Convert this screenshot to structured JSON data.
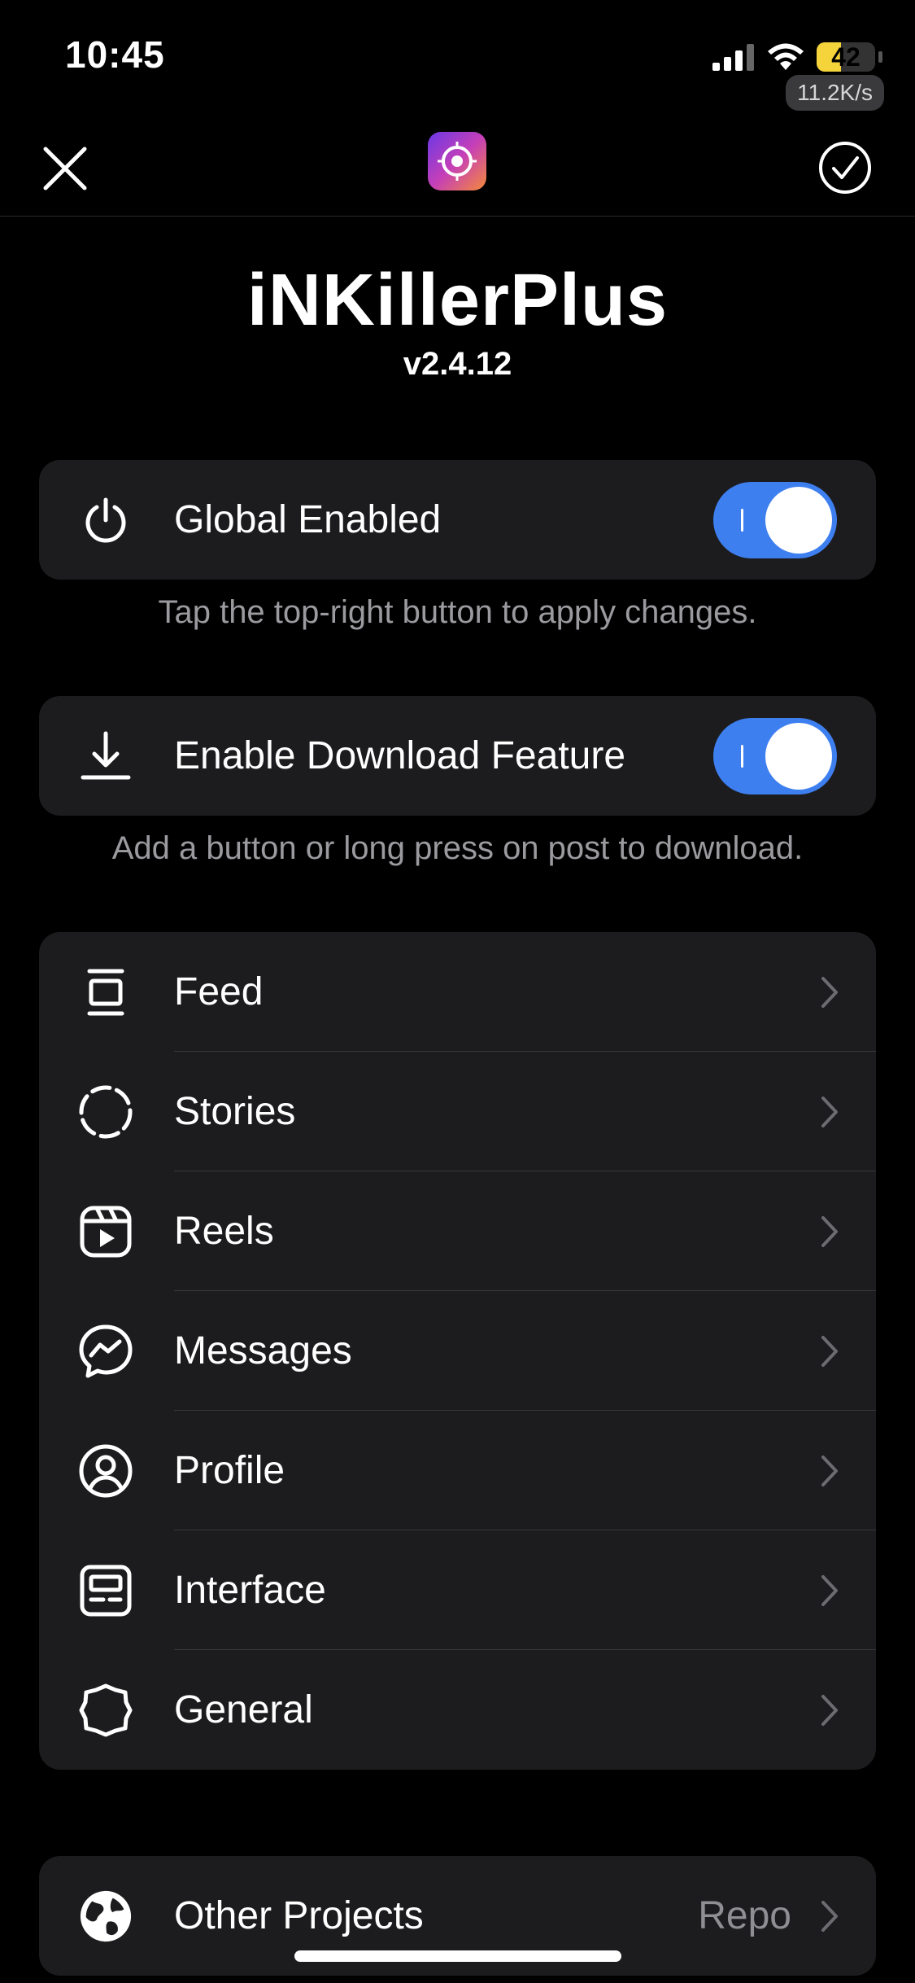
{
  "status_bar": {
    "time": "10:45",
    "battery_level": "42",
    "battery_fraction": 0.42,
    "speed": "11.2K/s",
    "icons": [
      "signal-icon",
      "wifi-icon",
      "battery-icon"
    ]
  },
  "nav": {
    "close_icon": "close-icon",
    "confirm_icon": "checkmark-circle-icon",
    "app_icon": "instagram-app-icon"
  },
  "header": {
    "title": "iNKillerPlus",
    "version": "v2.4.12"
  },
  "global": {
    "label": "Global Enabled",
    "enabled": true,
    "footer": "Tap the top-right button to apply changes.",
    "icon": "power-icon"
  },
  "download": {
    "label": "Enable Download Feature",
    "enabled": true,
    "footer": "Add a button or long press on post to download.",
    "icon": "download-icon"
  },
  "menu": {
    "items": [
      {
        "label": "Feed",
        "icon": "feed-icon"
      },
      {
        "label": "Stories",
        "icon": "stories-icon"
      },
      {
        "label": "Reels",
        "icon": "reels-icon"
      },
      {
        "label": "Messages",
        "icon": "messenger-icon"
      },
      {
        "label": "Profile",
        "icon": "profile-icon"
      },
      {
        "label": "Interface",
        "icon": "interface-icon"
      },
      {
        "label": "General",
        "icon": "gear-icon"
      }
    ]
  },
  "other": {
    "label": "Other Projects",
    "value": "Repo",
    "icon": "globe-icon"
  },
  "colors": {
    "background": "#000000",
    "card": "#1c1c1e",
    "accent": "#3e7ff0",
    "secondary_text": "#8e8e93"
  }
}
